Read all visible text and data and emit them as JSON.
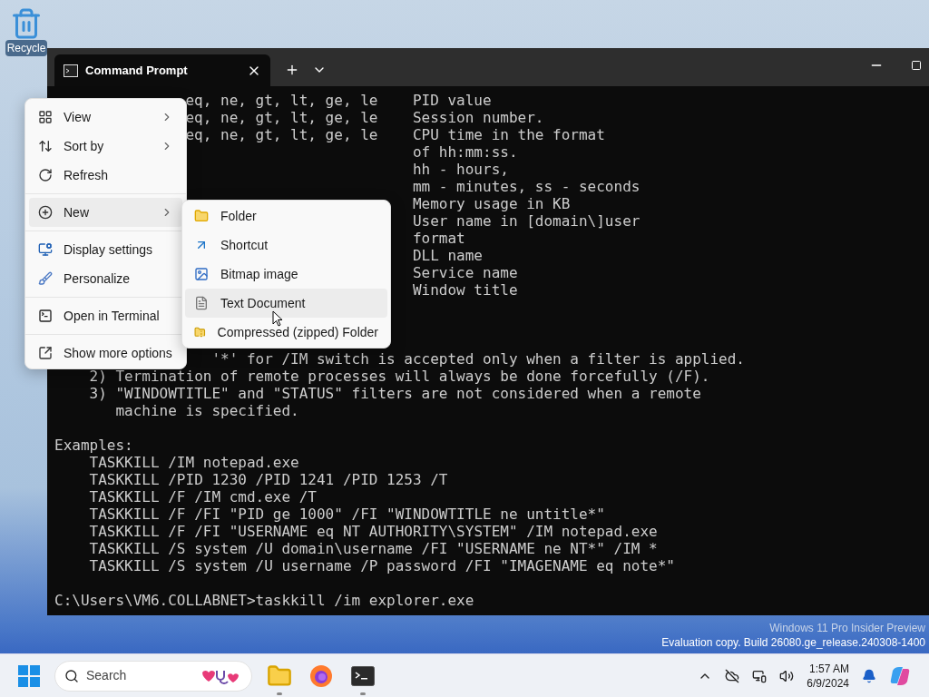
{
  "desktop": {
    "icons": [
      {
        "label": "Recycle"
      }
    ],
    "watermark": [
      "Windows 11 Pro Insider Preview",
      "Evaluation copy. Build 26080.ge_release.240308-1400"
    ]
  },
  "window": {
    "tab_title": "Command Prompt",
    "lines": [
      {
        "kind": "filter",
        "operators": "eq, ne, gt, lt, ge, le",
        "description": "PID value"
      },
      {
        "kind": "filter",
        "operators": "eq, ne, gt, lt, ge, le",
        "description": "Session number."
      },
      {
        "kind": "filter",
        "operators": "eq, ne, gt, lt, ge, le",
        "description": "CPU time in the format"
      },
      {
        "kind": "continuation",
        "description": "of hh:mm:ss."
      },
      {
        "kind": "continuation",
        "description": "hh - hours,"
      },
      {
        "kind": "continuation",
        "description": "mm - minutes, ss - seconds"
      },
      {
        "kind": "continuation",
        "description": "Memory usage in KB"
      },
      {
        "kind": "continuation",
        "description": "User name in [domain\\]user"
      },
      {
        "kind": "continuation",
        "description": "format"
      },
      {
        "kind": "continuation",
        "description": "DLL name"
      },
      {
        "kind": "continuation",
        "description": "Service name"
      },
      {
        "kind": "continuation",
        "description": "Window title"
      },
      {
        "kind": "blank"
      },
      {
        "kind": "blank"
      },
      {
        "kind": "blank"
      },
      {
        "kind": "tail",
        "text": "'*' for /IM switch is accepted only when a filter is applied."
      },
      {
        "kind": "item",
        "text": "2) Termination of remote processes will always be done forcefully (/F)."
      },
      {
        "kind": "item",
        "text": "3) \"WINDOWTITLE\" and \"STATUS\" filters are not considered when a remote"
      },
      {
        "kind": "item_cont",
        "text": "machine is specified."
      },
      {
        "kind": "blank"
      },
      {
        "kind": "text",
        "text": "Examples:"
      },
      {
        "kind": "item",
        "text": "TASKKILL /IM notepad.exe"
      },
      {
        "kind": "item",
        "text": "TASKKILL /PID 1230 /PID 1241 /PID 1253 /T"
      },
      {
        "kind": "item",
        "text": "TASKKILL /F /IM cmd.exe /T"
      },
      {
        "kind": "item",
        "text": "TASKKILL /F /FI \"PID ge 1000\" /FI \"WINDOWTITLE ne untitle*\""
      },
      {
        "kind": "item",
        "text": "TASKKILL /F /FI \"USERNAME eq NT AUTHORITY\\SYSTEM\" /IM notepad.exe"
      },
      {
        "kind": "item",
        "text": "TASKKILL /S system /U domain\\username /FI \"USERNAME ne NT*\" /IM *"
      },
      {
        "kind": "item",
        "text": "TASKKILL /S system /U username /P password /FI \"IMAGENAME eq note*\""
      },
      {
        "kind": "blank"
      },
      {
        "kind": "text",
        "text": "C:\\Users\\VM6.COLLABNET>taskkill /im explorer.exe"
      }
    ]
  },
  "context_menu": {
    "groups": [
      [
        {
          "kind": "view",
          "label": "View",
          "submenu": true,
          "selected": false
        },
        {
          "kind": "sort",
          "label": "Sort by",
          "submenu": true,
          "selected": false
        },
        {
          "kind": "refresh",
          "label": "Refresh",
          "submenu": false,
          "selected": false
        }
      ],
      [
        {
          "kind": "new",
          "label": "New",
          "submenu": true,
          "selected": true
        }
      ],
      [
        {
          "kind": "display",
          "label": "Display settings",
          "submenu": false,
          "selected": false
        },
        {
          "kind": "personalize",
          "label": "Personalize",
          "submenu": false,
          "selected": false
        }
      ],
      [
        {
          "kind": "terminal",
          "label": "Open in Terminal",
          "submenu": false,
          "selected": false
        }
      ],
      [
        {
          "kind": "more",
          "label": "Show more options",
          "submenu": false,
          "selected": false
        }
      ]
    ]
  },
  "new_submenu": {
    "items": [
      {
        "kind": "folder",
        "label": "Folder",
        "selected": false
      },
      {
        "kind": "shortcut",
        "label": "Shortcut",
        "selected": false
      },
      {
        "kind": "bitmap",
        "label": "Bitmap image",
        "selected": false
      },
      {
        "kind": "text",
        "label": "Text Document",
        "selected": true
      },
      {
        "kind": "zip",
        "label": "Compressed (zipped) Folder",
        "selected": false
      }
    ]
  },
  "taskbar": {
    "search": {
      "placeholder": "Search"
    },
    "apps": [
      {
        "kind": "explorer",
        "running": true
      },
      {
        "kind": "firefox",
        "running": false
      },
      {
        "kind": "terminal",
        "running": true
      }
    ],
    "time": "1:57 AM",
    "date": "6/9/2024"
  }
}
